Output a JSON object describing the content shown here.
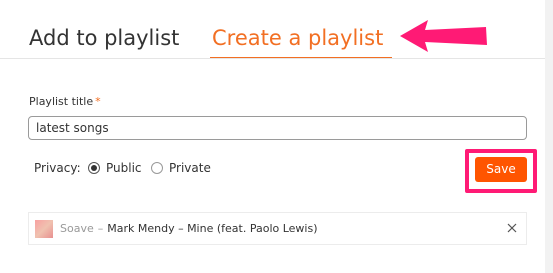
{
  "tabs": {
    "add_label": "Add to playlist",
    "create_label": "Create a playlist",
    "active": "create"
  },
  "form": {
    "title_label": "Playlist title",
    "required_marker": "*",
    "title_value": "latest songs",
    "privacy_label": "Privacy:",
    "privacy_options": [
      {
        "label": "Public",
        "checked": true
      },
      {
        "label": "Private",
        "checked": false
      }
    ],
    "save_label": "Save"
  },
  "track": {
    "artist": "Soave",
    "separator": "–",
    "title": "Mark Mendy – Mine (feat. Paolo Lewis)"
  },
  "icons": {
    "arrow": "arrow-left-icon",
    "remove": "close-icon",
    "artwork": "track-artwork"
  },
  "colors": {
    "accent": "#f26f23",
    "save_button": "#ff5500",
    "annotation": "#ff1a75"
  }
}
